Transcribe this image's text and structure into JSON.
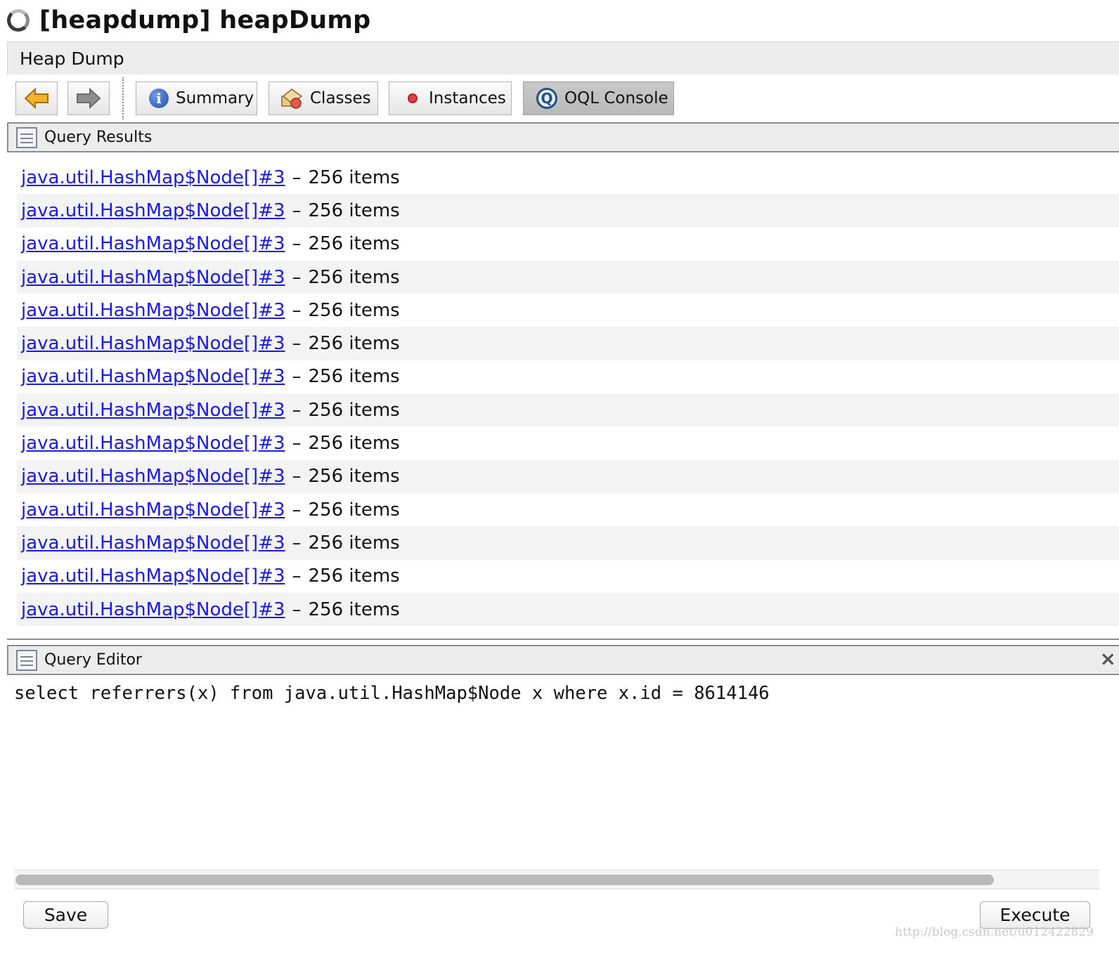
{
  "window": {
    "title": "[heapdump] heapDump"
  },
  "tabs": [
    {
      "label": "Heap Dump"
    }
  ],
  "toolbar": {
    "back_icon": "arrow-left-icon",
    "forward_icon": "arrow-right-icon",
    "buttons": [
      {
        "label": "Summary",
        "icon": "info-icon"
      },
      {
        "label": "Classes",
        "icon": "classes-icon"
      },
      {
        "label": "Instances",
        "icon": "record-icon"
      },
      {
        "label": "OQL Console",
        "icon": "oql-icon",
        "selected": true
      }
    ]
  },
  "query_results": {
    "title": "Query Results",
    "rows": [
      {
        "link": "java.util.HashMap$Node[]#3",
        "separator": "–",
        "count": "256 items"
      },
      {
        "link": "java.util.HashMap$Node[]#3",
        "separator": "–",
        "count": "256 items"
      },
      {
        "link": "java.util.HashMap$Node[]#3",
        "separator": "–",
        "count": "256 items"
      },
      {
        "link": "java.util.HashMap$Node[]#3",
        "separator": "–",
        "count": "256 items"
      },
      {
        "link": "java.util.HashMap$Node[]#3",
        "separator": "–",
        "count": "256 items"
      },
      {
        "link": "java.util.HashMap$Node[]#3",
        "separator": "–",
        "count": "256 items"
      },
      {
        "link": "java.util.HashMap$Node[]#3",
        "separator": "–",
        "count": "256 items"
      },
      {
        "link": "java.util.HashMap$Node[]#3",
        "separator": "–",
        "count": "256 items"
      },
      {
        "link": "java.util.HashMap$Node[]#3",
        "separator": "–",
        "count": "256 items"
      },
      {
        "link": "java.util.HashMap$Node[]#3",
        "separator": "–",
        "count": "256 items"
      },
      {
        "link": "java.util.HashMap$Node[]#3",
        "separator": "–",
        "count": "256 items"
      },
      {
        "link": "java.util.HashMap$Node[]#3",
        "separator": "–",
        "count": "256 items"
      },
      {
        "link": "java.util.HashMap$Node[]#3",
        "separator": "–",
        "count": "256 items"
      },
      {
        "link": "java.util.HashMap$Node[]#3",
        "separator": "–",
        "count": "256 items"
      }
    ]
  },
  "query_editor": {
    "title": "Query Editor",
    "close_icon": "close-icon",
    "query": "select referrers(x) from java.util.HashMap$Node x where x.id = 8614146"
  },
  "actions": {
    "save_label": "Save",
    "execute_label": "Execute"
  },
  "watermark": "http://blog.csdn.net/u012422829",
  "colors": {
    "link": "#1a1ae6",
    "selected_button": "#bdbdbd",
    "row_alt": "#f3f3f3"
  }
}
